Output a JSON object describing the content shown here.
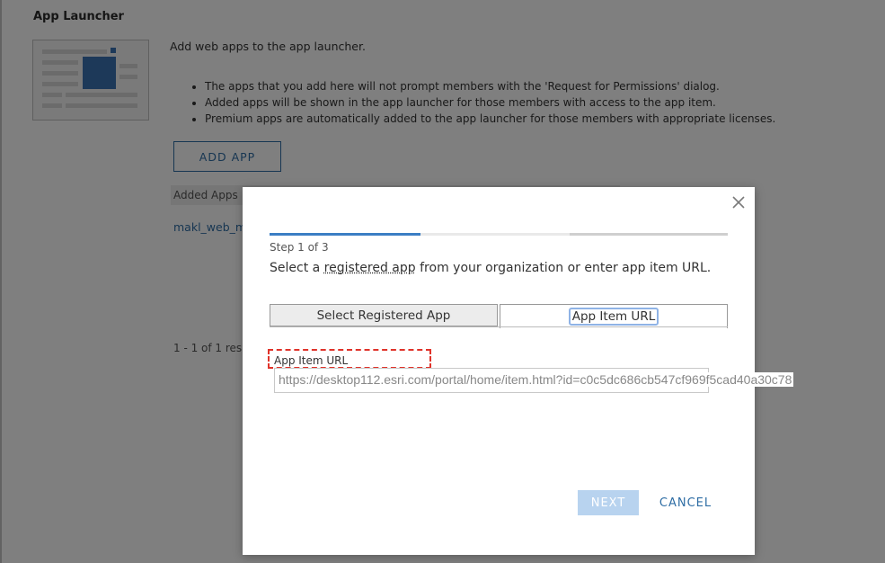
{
  "background": {
    "section_title": "App Launcher",
    "intro": "Add web apps to the app launcher.",
    "bullets": [
      "The apps that you add here will not prompt members with the 'Request for Permissions' dialog.",
      "Added apps will be shown in the app launcher for those members with access to the app item.",
      "Premium apps are automatically added to the app launcher for those members with appropriate licenses."
    ],
    "add_app_label": "ADD APP",
    "table_header": "Added Apps",
    "app_link": "makl_web_m",
    "pager": "1 - 1 of 1 res"
  },
  "dialog": {
    "close_icon": "close-icon",
    "step_text": "Step 1 of 3",
    "instruction_prefix": "Select a ",
    "instruction_link": "registered app",
    "instruction_suffix": " from your organization or enter app item URL.",
    "progress": {
      "current_step": 1,
      "total_steps": 3
    },
    "tabs": [
      {
        "label": "Select Registered App",
        "selected": false
      },
      {
        "label": "App Item URL",
        "selected": true
      }
    ],
    "field_label": "App Item URL",
    "url_value": "https://desktop112.esri.com/portal/home/item.html?id=c0c5dc686cb547cf969f5cad40a30c78",
    "next_label": "NEXT",
    "cancel_label": "CANCEL"
  },
  "colors": {
    "accent": "#2e6da4",
    "progress_active": "#3b7ec4",
    "annotation": "#e0332a",
    "next_disabled": "#b8d3ef"
  }
}
